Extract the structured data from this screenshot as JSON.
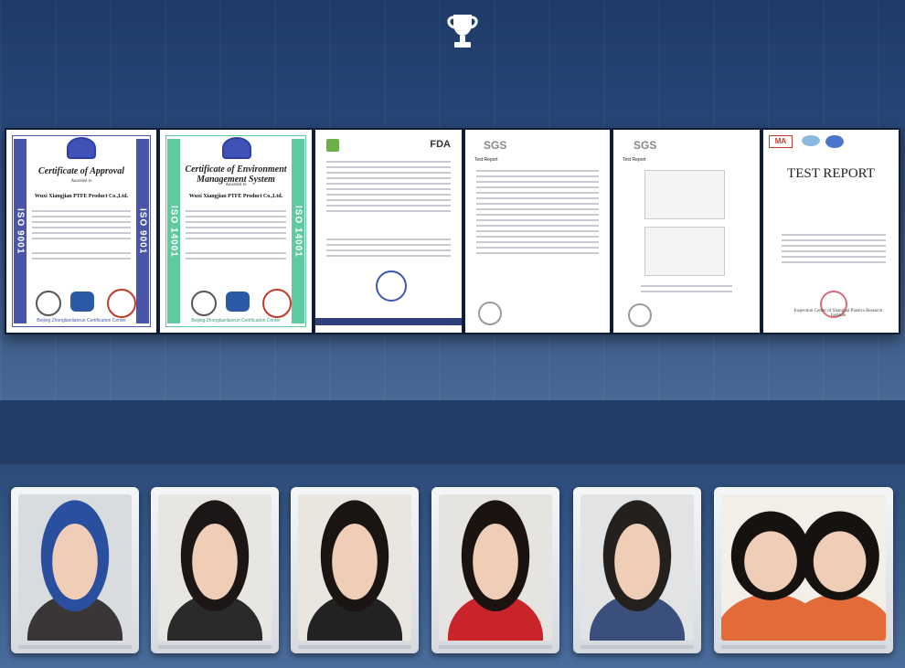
{
  "header": {
    "icon": "trophy-icon"
  },
  "certificates": [
    {
      "kind": "iso",
      "side": "ISO 9001",
      "accent": "#4a55a8",
      "title": "Certificate of Approval",
      "company": "Wuxi Xiangjian PTFE Product Co.,Ltd.",
      "awarded": "Awarded to",
      "footer": "Beijing Zhonglianlianrun Certification Center"
    },
    {
      "kind": "iso",
      "side": "ISO 14001",
      "accent": "#5fc9a0",
      "title": "Certificate of Environment Management System",
      "company": "Wuxi Xiangjian PTFE Product Co.,Ltd.",
      "awarded": "Awarded to",
      "footer": "Beijing Zhonglianlianrun Certification Center"
    },
    {
      "kind": "doc",
      "brand": "FDA"
    },
    {
      "kind": "doc",
      "brand": "SGS",
      "subhead": "Test Report"
    },
    {
      "kind": "doc",
      "brand": "SGS",
      "subhead": "Test Report"
    },
    {
      "kind": "report",
      "heading": "TEST REPORT",
      "stamp": "MA",
      "footer": "Inspection Center of Shanghai Plastics Research Institute"
    }
  ],
  "photos": [
    {
      "name": "staff-photo-1",
      "hair": "#2a4f9e",
      "shirt": "#3a3536",
      "bg": "#d9dcdf"
    },
    {
      "name": "staff-photo-2",
      "hair": "#1c1616",
      "shirt": "#2b2a2b",
      "bg": "#e8e6e2"
    },
    {
      "name": "staff-photo-3",
      "hair": "#1a1413",
      "shirt": "#222",
      "bg": "#e9e6e0"
    },
    {
      "name": "staff-photo-4",
      "hair": "#1a1310",
      "shirt": "#c8242a",
      "bg": "#e6e4e0"
    },
    {
      "name": "staff-photo-5",
      "hair": "#24201e",
      "shirt": "#3b4f7c",
      "bg": "#e2e3e4"
    },
    {
      "name": "staff-photo-6",
      "hair": "#161210",
      "shirt": "#e36b3a",
      "bg": "#f2efe8"
    }
  ]
}
